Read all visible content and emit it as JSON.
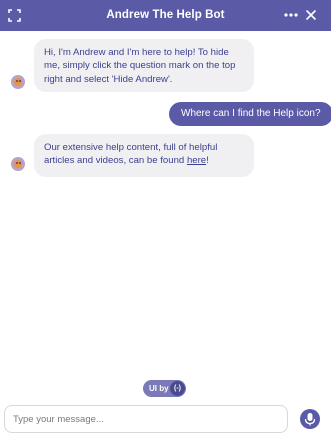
{
  "header": {
    "title": "Andrew The Help Bot",
    "expand_icon": "expand-icon",
    "more_icon": "more-dots-icon",
    "close_icon": "close-icon",
    "background": "#5a5aa6"
  },
  "messages": [
    {
      "sender": "bot",
      "text": "Hi, I'm Andrew and I'm here to help! To hide me, simply click the question mark on the top right and select 'Hide Andrew'."
    },
    {
      "sender": "user",
      "text": "Where can I find the Help icon?"
    },
    {
      "sender": "bot",
      "text_before": "Our extensive help content, full of helpful articles and videos, can be found ",
      "link_text": "here",
      "text_after": "!"
    }
  ],
  "footer": {
    "badge_label": "UI by",
    "badge_logo": "(-)",
    "input_placeholder": "Type your message...",
    "mic_icon": "microphone-icon"
  }
}
